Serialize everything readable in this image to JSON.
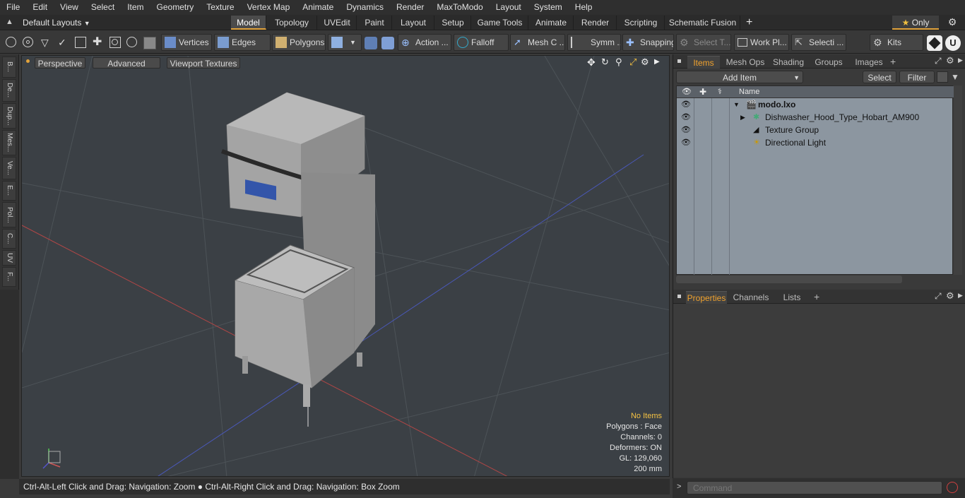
{
  "menu": [
    "File",
    "Edit",
    "View",
    "Select",
    "Item",
    "Geometry",
    "Texture",
    "Vertex Map",
    "Animate",
    "Dynamics",
    "Render",
    "MaxToModo",
    "Layout",
    "System",
    "Help"
  ],
  "layout_selector": "Default Layouts",
  "layout_tabs": [
    "Model",
    "Topology",
    "UVEdit",
    "Paint",
    "Layout",
    "Setup",
    "Game Tools",
    "Animate",
    "Render",
    "Scripting",
    "Schematic Fusion"
  ],
  "active_layout_tab": "Model",
  "only_label": "Only",
  "toolbar": {
    "vertices": "Vertices",
    "edges": "Edges",
    "polygons": "Polygons",
    "action": "Action ...",
    "falloff": "Falloff",
    "mesh": "Mesh C ...",
    "symm": "Symm ...",
    "snapping": "Snapping",
    "select_t": "Select T...",
    "work_pl": "Work Pl...",
    "selecti": "Selecti ...",
    "kits": "Kits"
  },
  "left_tabs": [
    "B...",
    "De...",
    "Dup...",
    "Mes...",
    "Ve...",
    "E...",
    "Pol...",
    "C...",
    "UV",
    "F..."
  ],
  "viewport": {
    "view_mode": "Perspective",
    "advanced": "Advanced",
    "textures": "Viewport Textures",
    "hud": [
      "No Items",
      "Polygons : Face",
      "Channels: 0",
      "Deformers: ON",
      "GL: 129,060",
      "200 mm"
    ]
  },
  "status_text": "Ctrl-Alt-Left Click and Drag: Navigation: Zoom ● Ctrl-Alt-Right Click and Drag: Navigation: Box Zoom",
  "items_panel": {
    "tabs": [
      "Items",
      "Mesh Ops",
      "Shading",
      "Groups",
      "Images"
    ],
    "active_tab": "Items",
    "add_item": "Add Item",
    "select": "Select",
    "filter": "Filter",
    "name_header": "Name",
    "rows": [
      {
        "name": "modo.lxo",
        "bold": true
      },
      {
        "name": "Dishwasher_Hood_Type_Hobart_AM900",
        "bold": false
      },
      {
        "name": "Texture Group",
        "bold": false
      },
      {
        "name": "Directional Light",
        "bold": false
      }
    ]
  },
  "properties_panel": {
    "tabs": [
      "Properties",
      "Channels",
      "Lists"
    ],
    "active_tab": "Properties"
  },
  "command_placeholder": "Command",
  "colors": {
    "accent": "#f0a22e",
    "active_tab_underline": "#e2a33b",
    "hud_highlight": "#f5c243"
  }
}
